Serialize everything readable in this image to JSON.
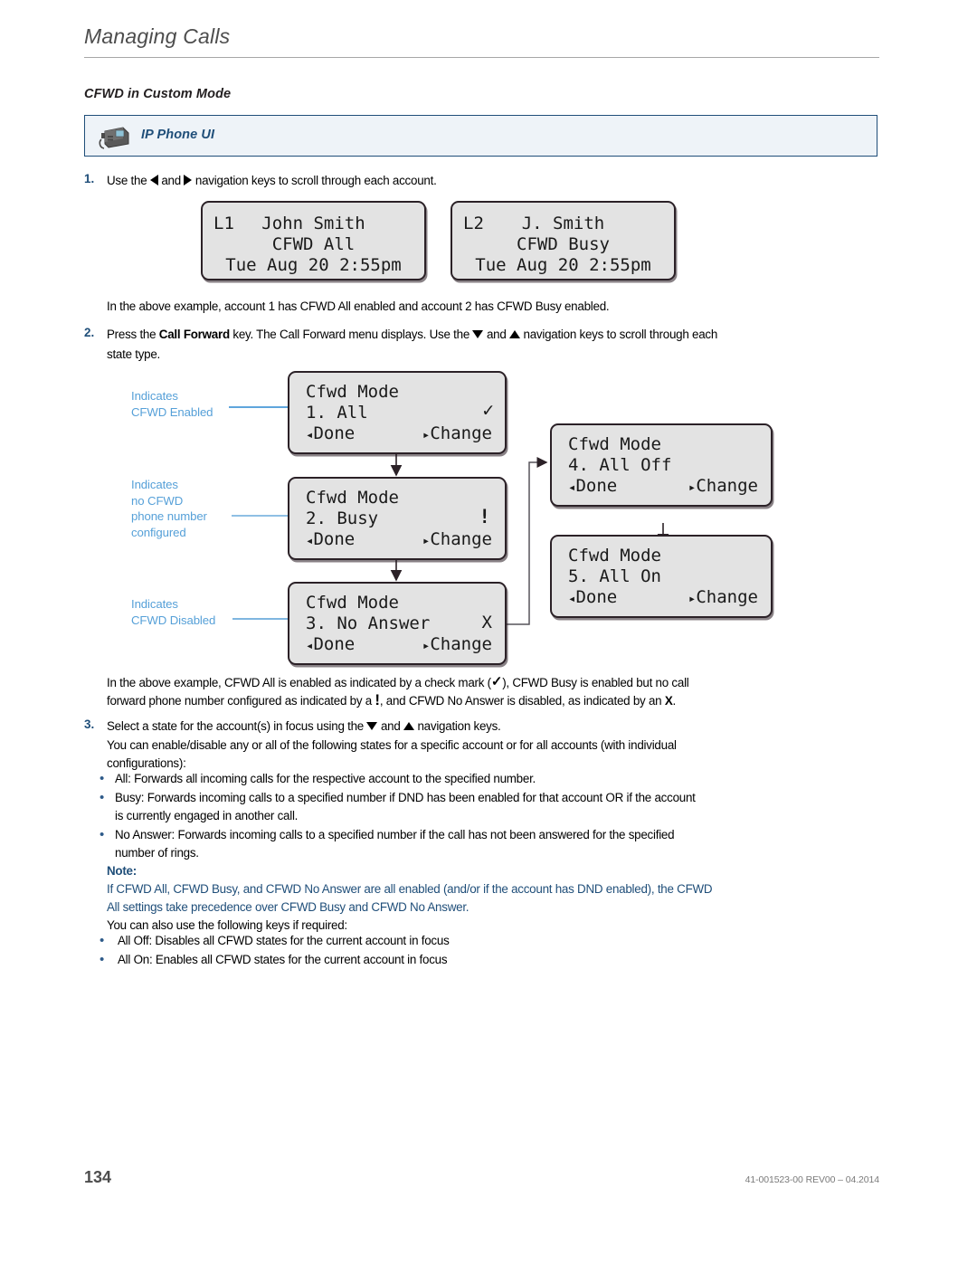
{
  "header": {
    "chapter_title": "Managing Calls",
    "section_heading": "CFWD in Custom Mode"
  },
  "ipui_banner": {
    "icon": "ip-phone-icon",
    "label": "IP Phone UI"
  },
  "steps": {
    "step1_num": "1.",
    "step1_pre": "Use the ",
    "step1_mid": " and ",
    "step1_post": " navigation keys to scroll through each account.",
    "note_after_screens": "In the above example, account 1 has CFWD All enabled and account 2 has CFWD Busy enabled.",
    "step2_num": "2.",
    "step2_a": "Press the ",
    "step2_bold": "Call Forward",
    "step2_b": " key. The Call Forward menu displays. Use the ",
    "step2_c": " and ",
    "step2_d": " navigation keys to scroll through each",
    "step2_line2": "state type.",
    "step3_num": "3.",
    "step3_a": "Select a state for the account(s) in focus using the ",
    "step3_b": " and ",
    "step3_c": " navigation keys.",
    "step3_line2": "You can enable/disable any or all of the following states for a specific account or for all accounts (with individual",
    "step3_line3": "configurations):"
  },
  "account_screens": [
    {
      "name": "line-1-screen",
      "left_label": "L1",
      "line1": "John Smith",
      "line2": "CFWD All",
      "line3": "Tue Aug 20 2:55pm"
    },
    {
      "name": "line-2-screen",
      "left_label": "L2",
      "line1": "J. Smith",
      "line2": "CFWD Busy",
      "line3": "Tue Aug 20 2:55pm"
    }
  ],
  "cfwd_screens": [
    {
      "id": "cfwd-mode-all",
      "title": "Cfwd Mode",
      "option": "1. All",
      "softkey_left": "Done",
      "softkey_right": "Change",
      "status_glyph": "✓",
      "status_meaning": "CFWD Enabled"
    },
    {
      "id": "cfwd-mode-busy",
      "title": "Cfwd Mode",
      "option": "2. Busy",
      "softkey_left": "Done",
      "softkey_right": "Change",
      "status_glyph": "!",
      "status_meaning": "no CFWD phone number configured"
    },
    {
      "id": "cfwd-mode-no-answer",
      "title": "Cfwd Mode",
      "option": "3. No Answer",
      "softkey_left": "Done",
      "softkey_right": "Change",
      "status_glyph": "X",
      "status_meaning": "CFWD Disabled"
    },
    {
      "id": "cfwd-mode-all-off",
      "title": "Cfwd Mode",
      "option": "4. All Off",
      "softkey_left": "Done",
      "softkey_right": "Change",
      "status_glyph": "",
      "status_meaning": ""
    },
    {
      "id": "cfwd-mode-all-on",
      "title": "Cfwd Mode",
      "option": "5. All On",
      "softkey_left": "Done",
      "softkey_right": "Change",
      "status_glyph": "",
      "status_meaning": ""
    }
  ],
  "annotations": [
    {
      "id": "annot-enabled",
      "line1": "Indicates",
      "line2": "CFWD Enabled",
      "line3": "",
      "line4": ""
    },
    {
      "id": "annot-no-number",
      "line1": "Indicates",
      "line2": "no CFWD",
      "line3": "phone number",
      "line4": "configured"
    },
    {
      "id": "annot-disabled",
      "id2": "x",
      "line1": "Indicates",
      "line2": "CFWD Disabled",
      "line3": "",
      "line4": ""
    }
  ],
  "explanation": {
    "line1_a": "In the above example, CFWD All is enabled as indicated by a check mark (",
    "line1_glyph": "✓",
    "line1_b": "), CFWD Busy is enabled but no call",
    "line2_a": "forward phone number configured as indicated by a ",
    "line2_glyph": "!",
    "line2_b": ", and CFWD No Answer is disabled, as indicated by an ",
    "line2_bold": "X",
    "line2_c": "."
  },
  "state_bullets": [
    "All: Forwards all incoming calls for the respective account to the specified number.",
    "Busy: Forwards incoming calls to a specified number if DND has been enabled for that account OR if the account",
    "is currently engaged in another call.",
    "No Answer: Forwards incoming calls to a specified number if the call has not been answered for the specified",
    "number of rings."
  ],
  "note": {
    "label": "Note:",
    "line1": "If CFWD All, CFWD Busy, and CFWD No Answer are all enabled (and/or if the account has DND enabled), the CFWD",
    "line2": "All settings take precedence over CFWD Busy and CFWD No Answer.",
    "line3": "You can also use the following keys if required:",
    "bullets": [
      "All Off: Disables all CFWD states for the current account in focus",
      "All On: Enables all CFWD states for the current account in focus"
    ]
  },
  "footer": {
    "page_number": "134",
    "doc_id": "41-001523-00 REV00 – 04.2014"
  },
  "colors": {
    "accent_blue": "#1f4e79",
    "annotation_blue": "#56a0d8",
    "note_blue": "#1f4e79",
    "lcd_bg": "#e3e3e3",
    "banner_bg": "#eef3f8"
  }
}
